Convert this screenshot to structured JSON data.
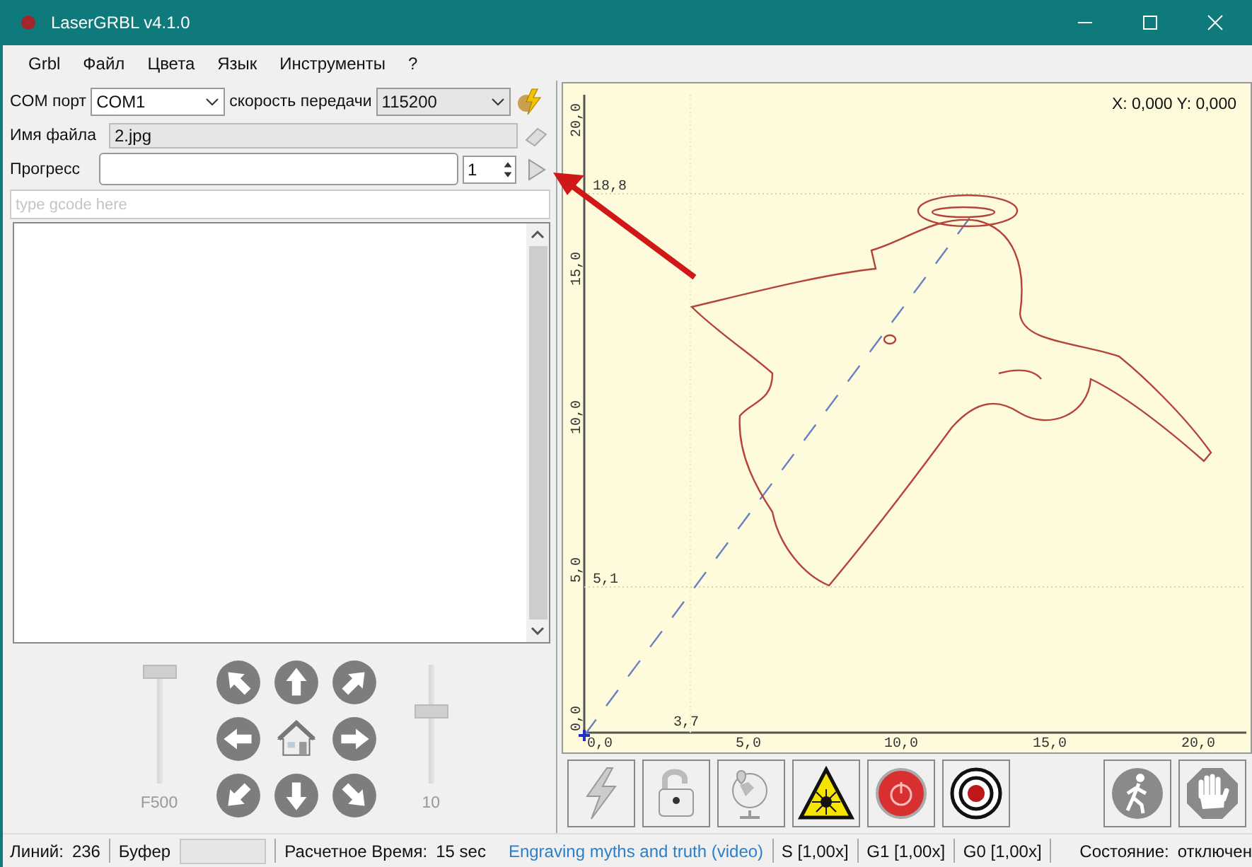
{
  "window": {
    "title": "LaserGRBL v4.1.0"
  },
  "menu": [
    "Grbl",
    "Файл",
    "Цвета",
    "Язык",
    "Инструменты",
    "?"
  ],
  "connection": {
    "port_label": "COM порт",
    "port": "COM1",
    "baud_label": "скорость передачи",
    "baud": "115200"
  },
  "file": {
    "label": "Имя файла",
    "value": "2.jpg"
  },
  "progress": {
    "label": "Прогресс",
    "level": 0,
    "copies": "1"
  },
  "gcode": {
    "placeholder": "type gcode here"
  },
  "jog": {
    "feed": {
      "label": "F500",
      "level": 1
    },
    "step": {
      "label": "10",
      "level": 0.62
    }
  },
  "preview": {
    "coords": "X: 0,000 Y: 0,000",
    "y_ticks": [
      "0,0",
      "5,0",
      "10,0",
      "15,0",
      "20,0"
    ],
    "x_ticks": [
      "0,0",
      "5,0",
      "10,0",
      "15,0",
      "20,0"
    ],
    "y_marks": [
      "18,8",
      "5,1"
    ],
    "x_marks": [
      "3,7"
    ]
  },
  "status_bar": {
    "lines_label": "Линий:",
    "lines": "236",
    "buffer_label": "Буфер",
    "buffer": {
      "level": 0
    },
    "time_label": "Расчетное Время:",
    "time": "15 sec",
    "link": "Engraving myths and truth (video)",
    "overrides": [
      "S [1,00x]",
      "G1 [1,00x]",
      "G0 [1,00x]"
    ],
    "state_label": "Состояние:",
    "state": "отключен"
  }
}
